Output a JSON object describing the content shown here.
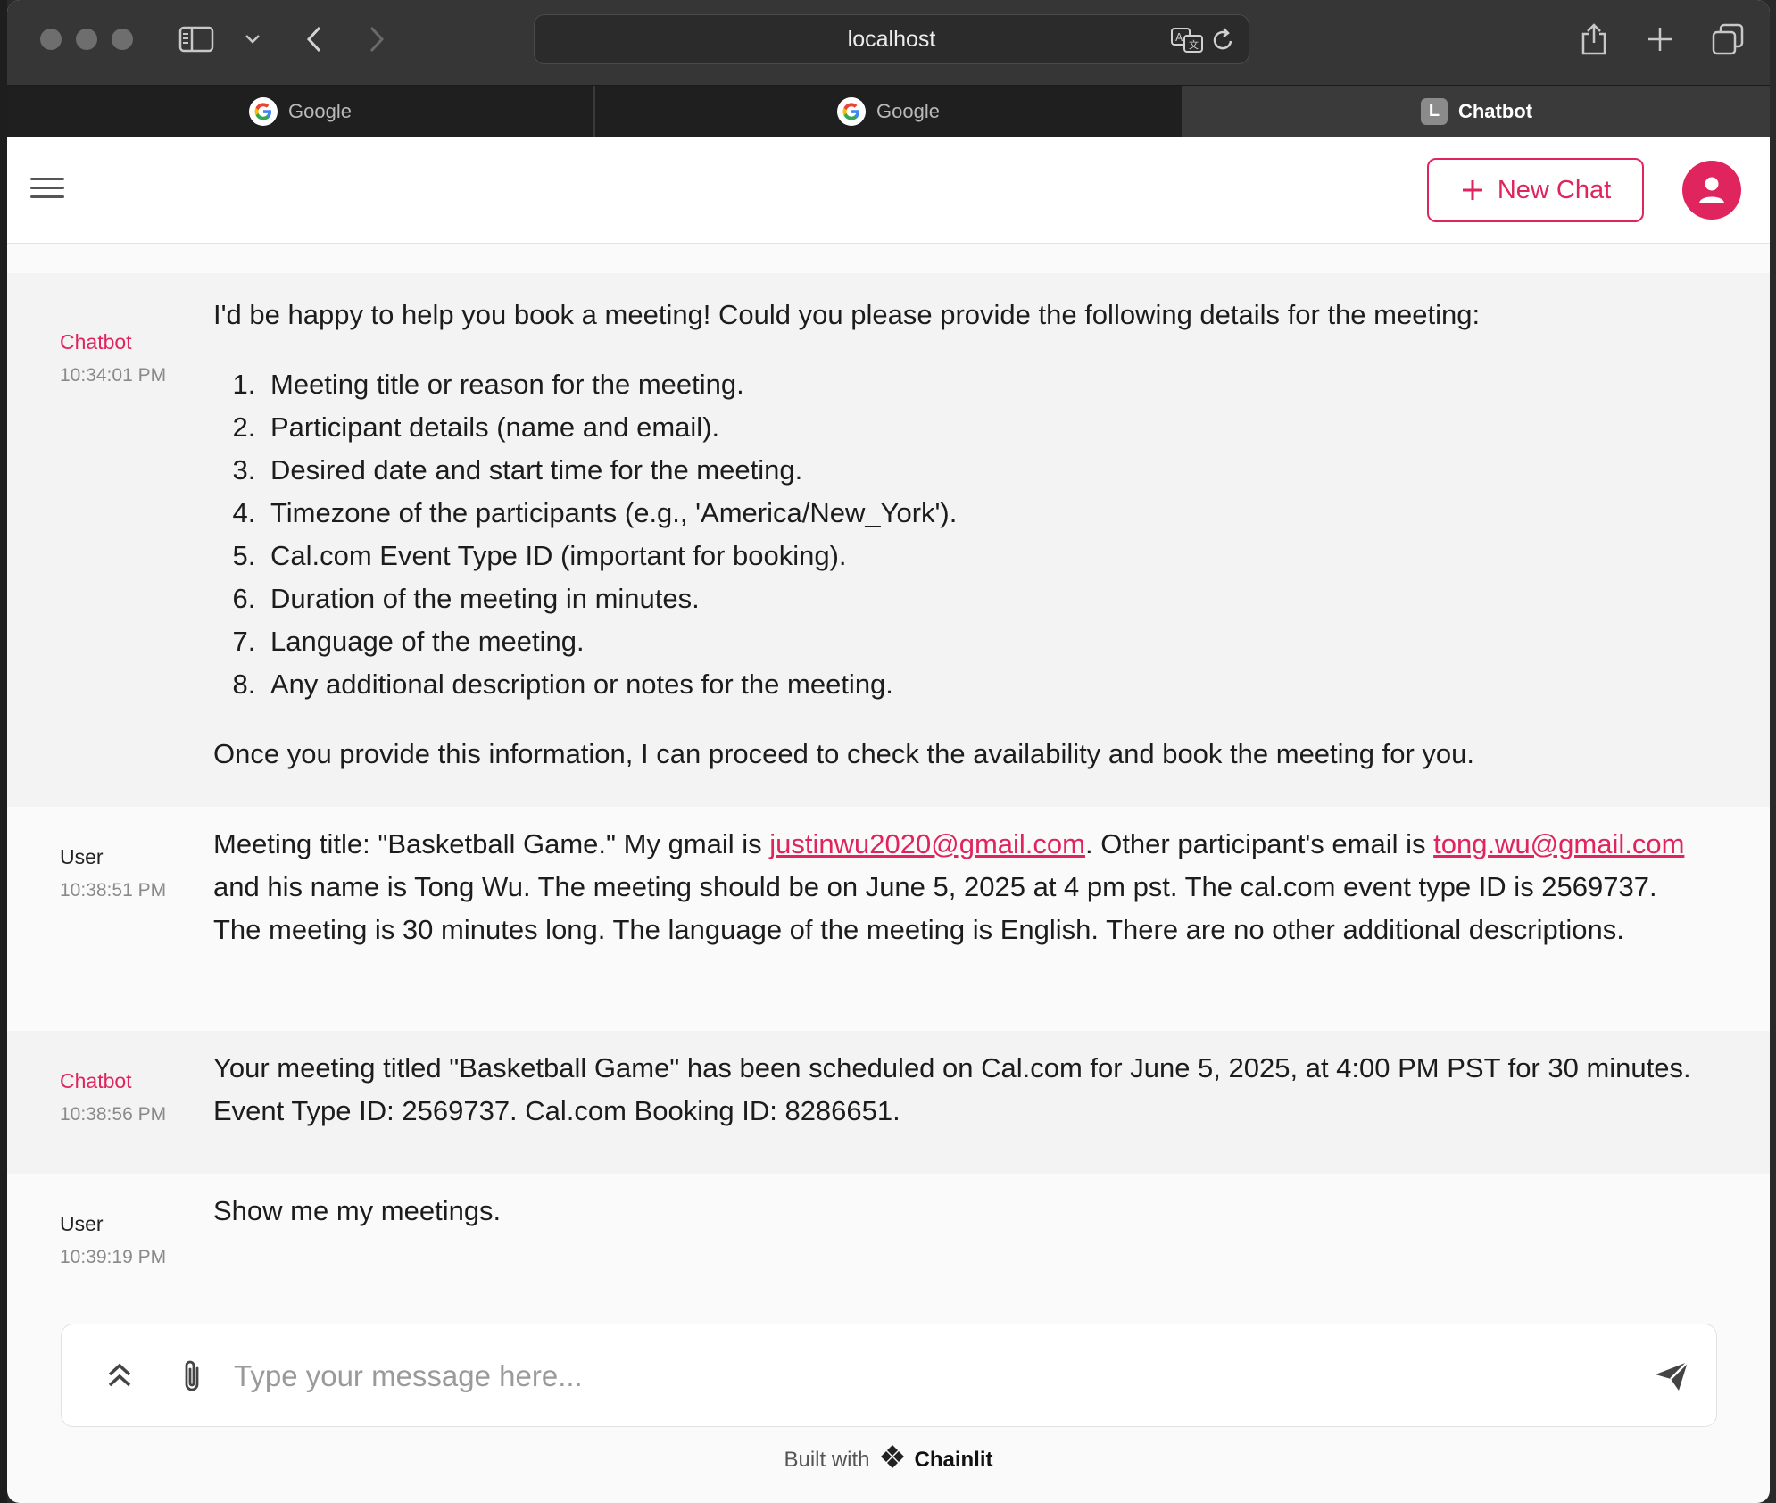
{
  "browser": {
    "address": "localhost",
    "tabs": [
      {
        "label": "Google"
      },
      {
        "label": "Google"
      },
      {
        "label": "Chatbot",
        "badge": "L"
      }
    ]
  },
  "header": {
    "new_chat_label": "New Chat"
  },
  "messages": [
    {
      "author": "Chatbot",
      "time": "10:34:01 PM",
      "intro": "I'd be happy to help you book a meeting! Could you please provide the following details for the meeting:",
      "items": [
        "Meeting title or reason for the meeting.",
        "Participant details (name and email).",
        "Desired date and start time for the meeting.",
        "Timezone of the participants (e.g., 'America/New_York').",
        "Cal.com Event Type ID (important for booking).",
        "Duration of the meeting in minutes.",
        "Language of the meeting.",
        "Any additional description or notes for the meeting."
      ],
      "outro": "Once you provide this information, I can proceed to check the availability and book the meeting for you."
    },
    {
      "author": "User",
      "time": "10:38:51 PM",
      "t1": "Meeting title: \"Basketball Game.\" My gmail is ",
      "link1": "justinwu2020@gmail.com",
      "t2": ". Other participant's email is ",
      "link2": "tong.wu@gmail.com",
      "t3": " and his name is Tong Wu. The meeting should be on June 5, 2025 at 4 pm pst. The cal.com event type ID is 2569737. The meeting is 30 minutes long. The language of the meeting is  English. There are no other additional descriptions."
    },
    {
      "author": "Chatbot",
      "time": "10:38:56 PM",
      "text": "Your meeting titled \"Basketball Game\" has been scheduled on Cal.com for June 5, 2025, at 4:00 PM PST for 30 minutes. Event Type ID: 2569737. Cal.com Booking ID: 8286651."
    },
    {
      "author": "User",
      "time": "10:39:19 PM",
      "text": "Show me my meetings."
    }
  ],
  "composer": {
    "placeholder": "Type your message here..."
  },
  "footer": {
    "built_with": "Built with",
    "brand": "Chainlit"
  },
  "colors": {
    "accent": "#e0245e",
    "chrome": "#363636"
  }
}
